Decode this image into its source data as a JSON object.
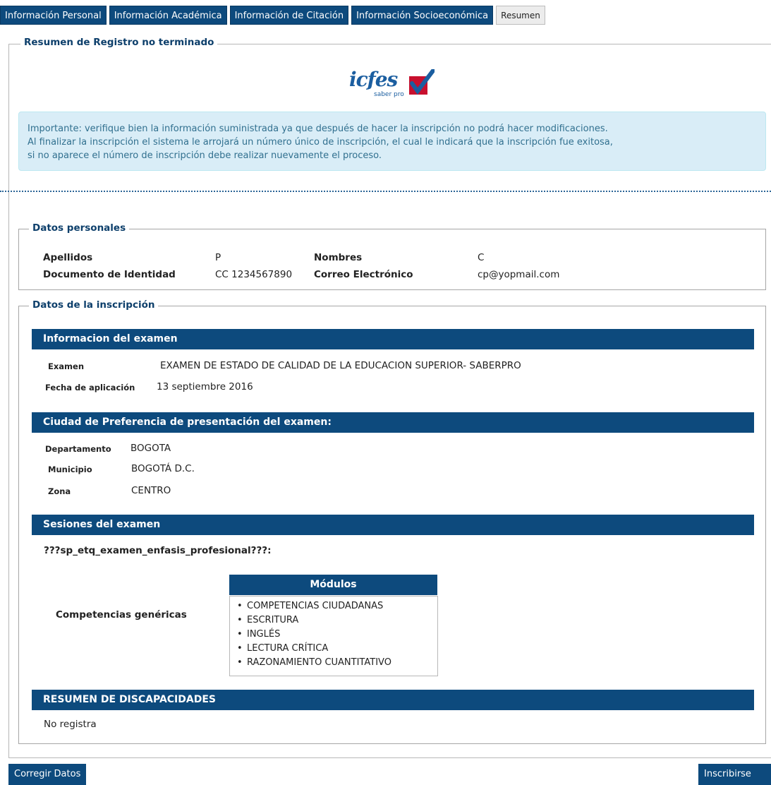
{
  "tabs": [
    {
      "label": "Información Personal"
    },
    {
      "label": "Información Académica"
    },
    {
      "label": "Información de Citación"
    },
    {
      "label": "Información Socioeconómica"
    },
    {
      "label": "Resumen"
    }
  ],
  "main_legend": "Resumen de Registro no terminado",
  "logo": {
    "text": "icfes",
    "subtext": "saber pro"
  },
  "alert": {
    "line1": "Importante: verifique bien la información suministrada ya que después de hacer la inscripción no podrá hacer modificaciones.",
    "line2": "Al finalizar la inscripción el sistema le arrojará un número único de inscripción, el cual le indicará que la inscripción fue exitosa,",
    "line3": "si no aparece el número de inscripción debe realizar nuevamente el proceso."
  },
  "personal": {
    "legend": "Datos personales",
    "apellidos_label": "Apellidos",
    "apellidos_value": "P",
    "nombres_label": "Nombres",
    "nombres_value": "C",
    "doc_label": "Documento de Identidad",
    "doc_value": "CC 1234567890",
    "correo_label": "Correo Electrónico",
    "correo_value": "cp@yopmail.com"
  },
  "inscripcion": {
    "legend": "Datos de la inscripción",
    "exam_bar": "Informacion del examen",
    "examen_label": "Examen",
    "examen_value": "EXAMEN DE ESTADO DE CALIDAD DE LA EDUCACION SUPERIOR- SABERPRO",
    "fecha_label": "Fecha de aplicación",
    "fecha_value": "13 septiembre 2016",
    "ciudad_bar": "Ciudad de Preferencia de presentación del examen:",
    "depto_label": "Departamento",
    "depto_value": "BOGOTA",
    "muni_label": "Municipio",
    "muni_value": "BOGOTÁ D.C.",
    "zona_label": "Zona",
    "zona_value": "CENTRO",
    "sesiones_bar": "Sesiones del examen",
    "enfasis": "???sp_etq_examen_enfasis_profesional???:",
    "competencias": "Competencias genéricas",
    "modulos_head": "Módulos",
    "modulos": [
      "COMPETENCIAS CIUDADANAS",
      "ESCRITURA",
      "INGLÉS",
      "LECTURA CRÍTICA",
      "RAZONAMIENTO CUANTITATIVO"
    ],
    "discap_bar": "RESUMEN DE DISCAPACIDADES",
    "discap_value": "No registra"
  },
  "buttons": {
    "corregir": "Corregir Datos",
    "inscribirse": "Inscribirse"
  }
}
